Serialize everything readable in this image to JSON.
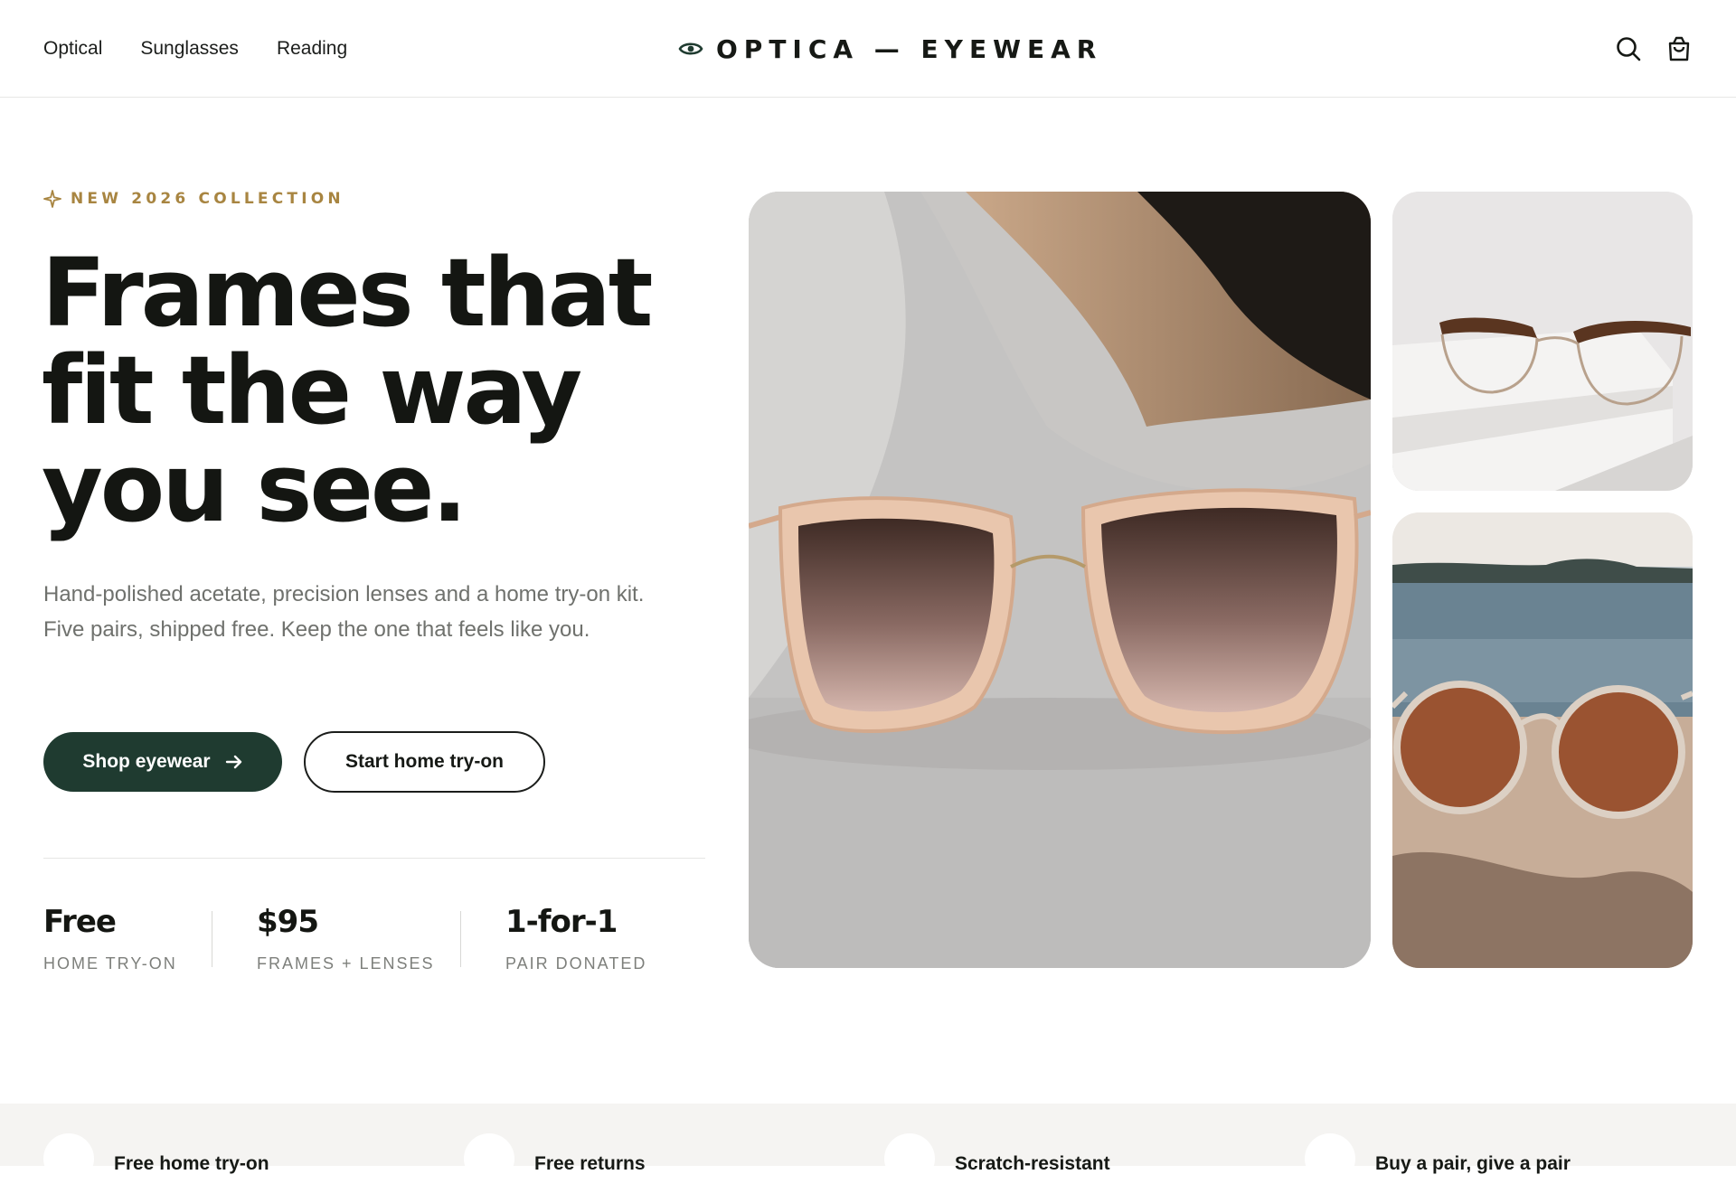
{
  "nav": {
    "items": [
      "Optical",
      "Sunglasses",
      "Reading"
    ]
  },
  "brand": {
    "name": "OPTICA — EYEWEAR"
  },
  "header_icons": [
    "search-icon",
    "bag-icon",
    "eye-icon"
  ],
  "hero": {
    "eyebrow": "NEW 2026 COLLECTION",
    "title_lines": [
      "Frames that",
      "fit the way",
      "you see."
    ],
    "description": "Hand-polished acetate, precision lenses and a home try-on kit. Five pairs, shipped free. Keep the one that feels like you.",
    "primary_cta": "Shop eyewear",
    "secondary_cta": "Start home try-on"
  },
  "stats": [
    {
      "value": "Free",
      "label": "HOME TRY-ON"
    },
    {
      "value": "$95",
      "label": "FRAMES + LENSES"
    },
    {
      "value": "1-for-1",
      "label": "PAIR DONATED"
    }
  ],
  "features": [
    {
      "title": "Free home try-on"
    },
    {
      "title": "Free returns"
    },
    {
      "title": "Scratch-resistant"
    },
    {
      "title": "Buy a pair, give a pair"
    }
  ],
  "colors": {
    "accent": "#1f3b30",
    "eyebrow": "#a88541",
    "text": "#161915",
    "muted": "#6f716d"
  }
}
